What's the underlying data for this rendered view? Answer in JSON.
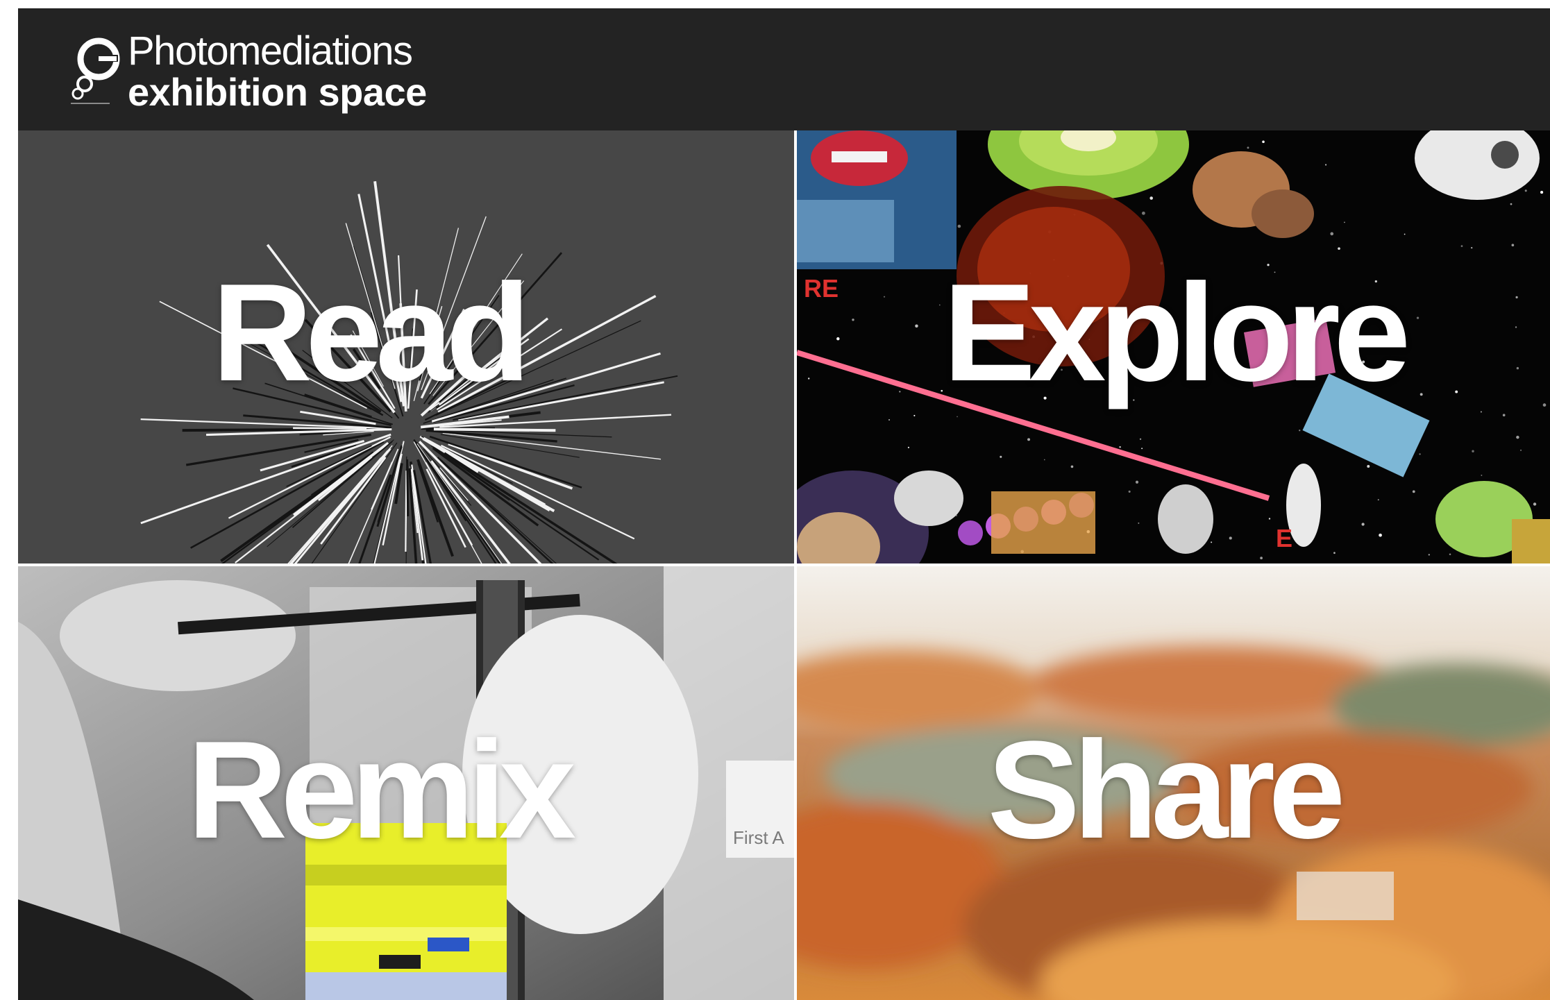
{
  "header": {
    "logo_line1": "Photomediations",
    "logo_line2": "exhibition space",
    "logo_icon": "camera-circles-logo-icon"
  },
  "tiles": [
    {
      "label": "Read",
      "image": "starburst-lines-image"
    },
    {
      "label": "Explore",
      "image": "space-collage-image"
    },
    {
      "label": "Remix",
      "image": "hands-film-glitch-image"
    },
    {
      "label": "Share",
      "image": "blurred-autumn-landscape-image"
    }
  ],
  "colors": {
    "header_bg": "#232323",
    "label": "#ffffff",
    "read_bg": "#474747",
    "explore_bg": "#050505",
    "share_orange": "#d9783a"
  }
}
